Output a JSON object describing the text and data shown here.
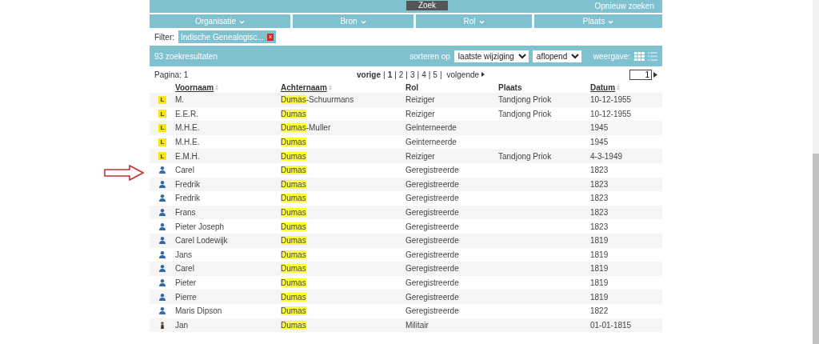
{
  "search": {
    "button": "Zoek",
    "reset_link": "Opnieuw zoeken"
  },
  "facets": [
    {
      "label": "Organisatie"
    },
    {
      "label": "Bron"
    },
    {
      "label": "Rol"
    },
    {
      "label": "Plaats"
    }
  ],
  "filter": {
    "label": "Filter:",
    "tag": "Indische Genealogisc...",
    "remove": "x"
  },
  "results": {
    "count": "93 zoekresultaten",
    "sort_label": "sorteren op",
    "sort_field": "laatste wijziging",
    "sort_order": "aflopend",
    "view_label": "weergave:",
    "views": [
      {
        "kind": "grid",
        "selected": true
      },
      {
        "kind": "list",
        "selected": false
      }
    ]
  },
  "pagination": {
    "page_label": "Pagina: 1",
    "prev": "vorige",
    "separator": "|",
    "pages": [
      {
        "label": "1",
        "selected": true
      },
      {
        "label": "2",
        "selected": false
      },
      {
        "label": "3",
        "selected": false
      },
      {
        "label": "4",
        "selected": false
      },
      {
        "label": "5",
        "selected": false
      }
    ],
    "next": "volgende",
    "page_input": "1"
  },
  "table": {
    "columns": [
      {
        "label": "Voornaam",
        "sortable": true
      },
      {
        "label": "Achternaam",
        "sortable": true
      },
      {
        "label": "Rol",
        "sortable": false
      },
      {
        "label": "Plaats",
        "sortable": false
      },
      {
        "label": "Datum",
        "sortable": true
      }
    ],
    "rows": [
      {
        "kind": "letter",
        "badge": "L",
        "first": "M.",
        "surname_match": "Dumas",
        "surname_rest": "-Schuurmans",
        "role": "Reiziger",
        "place": "Tandjong Priok",
        "date": "10-12-1955"
      },
      {
        "kind": "letter",
        "badge": "L",
        "first": "E.E.R.",
        "surname_match": "Dumas",
        "surname_rest": "",
        "role": "Reiziger",
        "place": "Tandjong Priok",
        "date": "10-12-1955"
      },
      {
        "kind": "letter",
        "badge": "L",
        "first": "M.H.E.",
        "surname_match": "Dumas",
        "surname_rest": "-Muller",
        "role": "Geinterneerde",
        "place": "",
        "date": "1945"
      },
      {
        "kind": "letter",
        "badge": "L",
        "first": "M.H.E.",
        "surname_match": "Dumas",
        "surname_rest": "",
        "role": "Geinterneerde",
        "place": "",
        "date": "1945"
      },
      {
        "kind": "letter",
        "badge": "L",
        "first": "E.M.H.",
        "surname_match": "Dumas",
        "surname_rest": "",
        "role": "Reiziger",
        "place": "Tandjong Priok",
        "date": "4-3-1949"
      },
      {
        "kind": "person",
        "first": "Carel",
        "surname_match": "Dumas",
        "surname_rest": "",
        "role": "Geregistreerde",
        "place": "",
        "date": "1823"
      },
      {
        "kind": "person",
        "first": "Fredrik",
        "surname_match": "Dumas",
        "surname_rest": "",
        "role": "Geregistreerde",
        "place": "",
        "date": "1823"
      },
      {
        "kind": "person",
        "first": "Fredrik",
        "surname_match": "Dumas",
        "surname_rest": "",
        "role": "Geregistreerde",
        "place": "",
        "date": "1823"
      },
      {
        "kind": "person",
        "first": "Frans",
        "surname_match": "Dumas",
        "surname_rest": "",
        "role": "Geregistreerde",
        "place": "",
        "date": "1823"
      },
      {
        "kind": "person",
        "first": "Pieter Joseph",
        "surname_match": "Dumas",
        "surname_rest": "",
        "role": "Geregistreerde",
        "place": "",
        "date": "1823"
      },
      {
        "kind": "person",
        "first": "Carel Lodewijk",
        "surname_match": "Dumas",
        "surname_rest": "",
        "role": "Geregistreerde",
        "place": "",
        "date": "1819"
      },
      {
        "kind": "person",
        "first": "Jans",
        "surname_match": "Dumas",
        "surname_rest": "",
        "role": "Geregistreerde",
        "place": "",
        "date": "1819"
      },
      {
        "kind": "person",
        "first": "Carel",
        "surname_match": "Dumas",
        "surname_rest": "",
        "role": "Geregistreerde",
        "place": "",
        "date": "1819"
      },
      {
        "kind": "person",
        "first": "Pieter",
        "surname_match": "Dumas",
        "surname_rest": "",
        "role": "Geregistreerde",
        "place": "",
        "date": "1819"
      },
      {
        "kind": "person",
        "first": "Pierre",
        "surname_match": "Dumas",
        "surname_rest": "",
        "role": "Geregistreerde",
        "place": "",
        "date": "1819"
      },
      {
        "kind": "person",
        "first": "Maris Dipson",
        "surname_match": "Dumas",
        "surname_rest": "",
        "role": "Geregistreerde",
        "place": "",
        "date": "1822"
      },
      {
        "kind": "soldier",
        "first": "Jan",
        "surname_match": "Dumas",
        "surname_rest": "",
        "role": "Militair",
        "place": "",
        "date": "01-01-1815"
      }
    ]
  }
}
